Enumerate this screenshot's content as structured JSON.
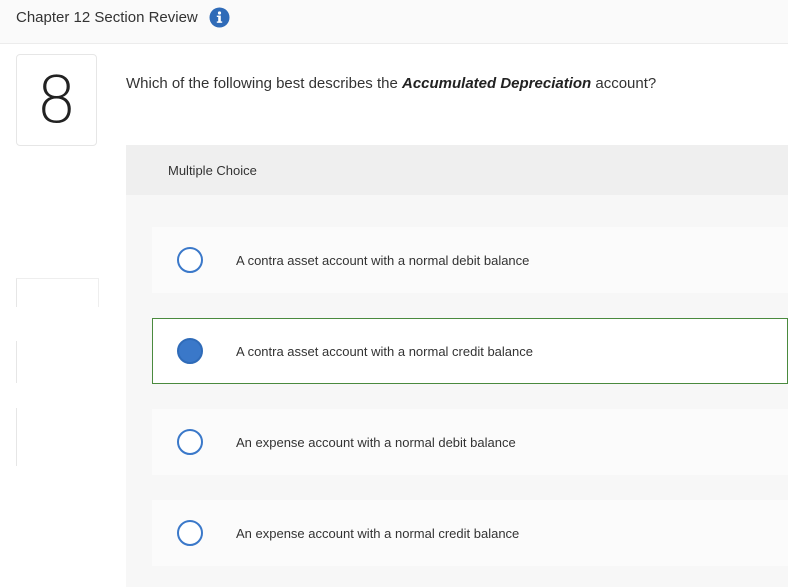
{
  "header": {
    "title": "Chapter 12 Section Review",
    "info_icon": "info-icon"
  },
  "question": {
    "number": "8",
    "prefix": "Which of the following best describes the ",
    "term": "Accumulated Depreciation",
    "suffix": " account?"
  },
  "multiple_choice": {
    "label": "Multiple Choice",
    "selected_index": 1,
    "options": [
      "A contra asset account with a normal debit balance",
      "A contra asset account with a normal credit balance",
      "An expense account with a normal debit balance",
      "An expense account with a normal credit balance"
    ]
  },
  "colors": {
    "accent_blue": "#3a78c9",
    "selected_border_green": "#4a8a3e"
  }
}
